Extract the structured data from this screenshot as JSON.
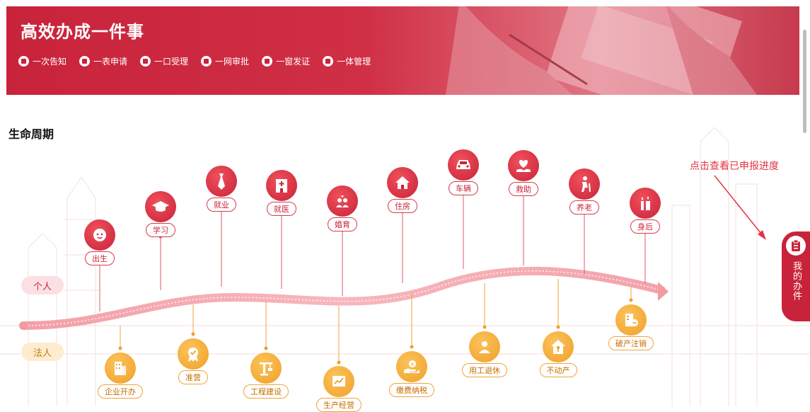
{
  "banner": {
    "title": "高效办成一件事",
    "features": [
      {
        "label": "一次告知",
        "icon": "notice-icon"
      },
      {
        "label": "一表申请",
        "icon": "form-icon"
      },
      {
        "label": "一口受理",
        "icon": "accept-icon"
      },
      {
        "label": "一网审批",
        "icon": "approve-icon"
      },
      {
        "label": "一窗发证",
        "icon": "certificate-icon"
      },
      {
        "label": "一体管理",
        "icon": "manage-icon"
      }
    ]
  },
  "lifecycle": {
    "title": "生命周期",
    "person_label": "个人",
    "legal_label": "法人",
    "hint": "点击查看已申报进度",
    "person_nodes": [
      {
        "label": "出生",
        "icon": "baby-icon"
      },
      {
        "label": "学习",
        "icon": "graduation-cap-icon"
      },
      {
        "label": "就业",
        "icon": "tie-icon"
      },
      {
        "label": "就医",
        "icon": "hospital-icon"
      },
      {
        "label": "婚育",
        "icon": "family-icon"
      },
      {
        "label": "住房",
        "icon": "house-icon"
      },
      {
        "label": "车辆",
        "icon": "car-icon"
      },
      {
        "label": "救助",
        "icon": "heart-hand-icon"
      },
      {
        "label": "养老",
        "icon": "elderly-icon"
      },
      {
        "label": "身后",
        "icon": "candle-icon"
      }
    ],
    "legal_nodes": [
      {
        "label": "企业开办",
        "icon": "building-icon"
      },
      {
        "label": "准营",
        "icon": "badge-icon"
      },
      {
        "label": "工程建设",
        "icon": "crane-icon"
      },
      {
        "label": "生产经营",
        "icon": "chart-icon"
      },
      {
        "label": "缴费纳税",
        "icon": "tax-hand-icon"
      },
      {
        "label": "用工退休",
        "icon": "worker-icon"
      },
      {
        "label": "不动产",
        "icon": "property-icon"
      },
      {
        "label": "破产注销",
        "icon": "document-cancel-icon"
      }
    ]
  },
  "side_button": {
    "label": "我的办件",
    "icon": "clipboard-icon"
  },
  "colors": {
    "primary_red": "#c8233b",
    "accent_orange": "#f0a02a"
  }
}
